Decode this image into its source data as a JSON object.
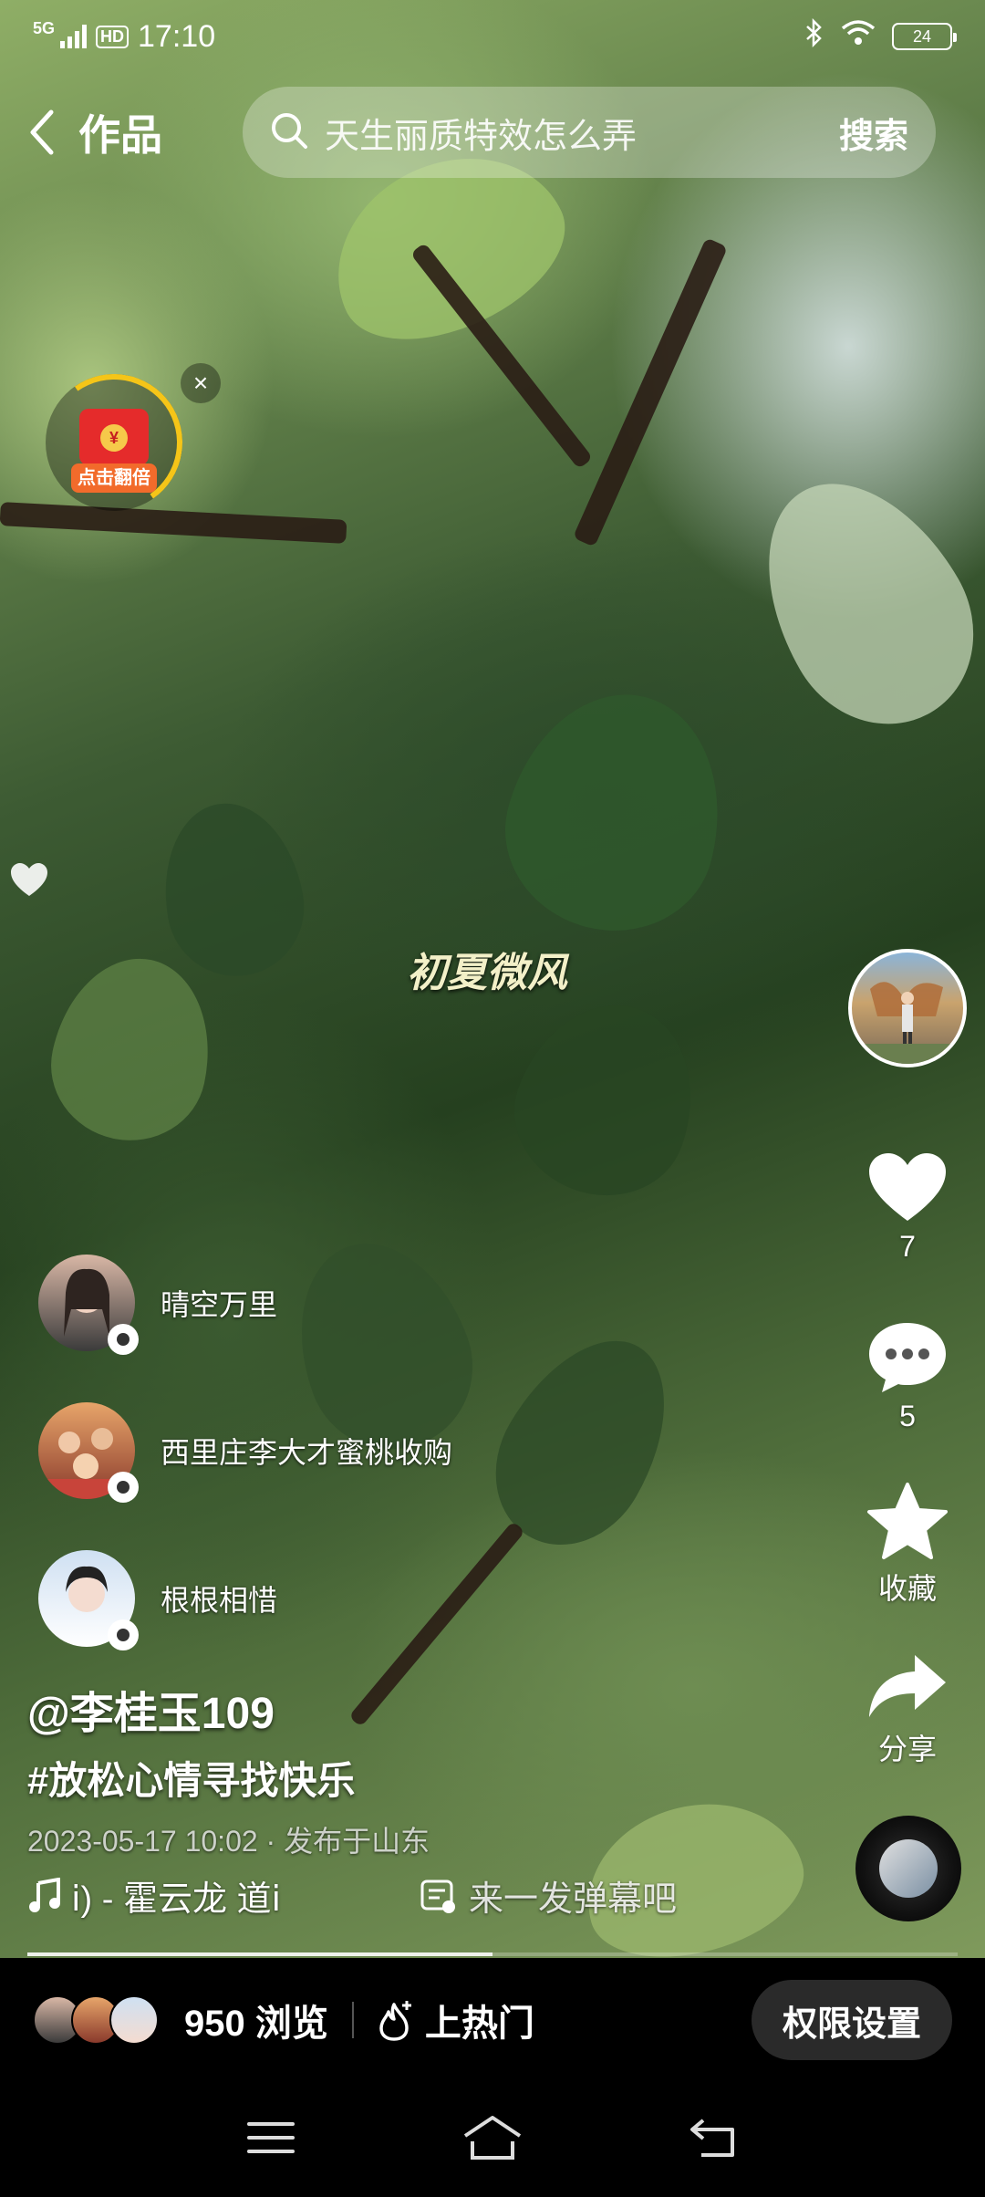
{
  "status_bar": {
    "network": "5G",
    "hd": "HD",
    "time": "17:10",
    "battery": "24"
  },
  "top_nav": {
    "back_label": "作品",
    "search_placeholder": "天生丽质特效怎么弄",
    "search_button": "搜索"
  },
  "red_packet": {
    "label": "点击翻倍",
    "coin": "¥"
  },
  "video": {
    "caption": "初夏微风"
  },
  "actions": {
    "like_count": "7",
    "comment_count": "5",
    "favorite_label": "收藏",
    "share_label": "分享"
  },
  "viewers": [
    {
      "name": "晴空万里",
      "color_a": "#d9b7a6",
      "color_b": "#3b3b3b"
    },
    {
      "name": "西里庄李大才蜜桃收购",
      "color_a": "#e7a56a",
      "color_b": "#8a3a2c"
    },
    {
      "name": "根根相惜",
      "color_a": "#cfe0f2",
      "color_b": "#2a2a2a"
    }
  ],
  "post": {
    "author": "@李桂玉109",
    "hashtag": "#放松心情寻找快乐",
    "meta": "2023-05-17 10:02 · 发布于山东",
    "music": "ⅰ) - 霍云龙   道ⅰ",
    "danmu_placeholder": "来一发弹幕吧"
  },
  "progress": 0.5,
  "bottom_bar": {
    "views": "950 浏览",
    "hot_label": "上热门",
    "permission_button": "权限设置"
  },
  "colors": {
    "accent_gold": "#f5c518",
    "red_packet": "#e52b2b"
  }
}
